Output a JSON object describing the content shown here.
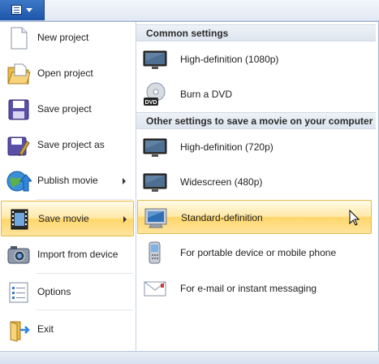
{
  "app_menu": {
    "left_items": [
      {
        "label": "New project",
        "icon": "new-project-icon",
        "has_submenu": false
      },
      {
        "label": "Open project",
        "icon": "open-project-icon",
        "has_submenu": false
      },
      {
        "label": "Save project",
        "icon": "save-project-icon",
        "has_submenu": false
      },
      {
        "label": "Save project as",
        "icon": "save-project-as-icon",
        "has_submenu": false
      },
      {
        "label": "Publish movie",
        "icon": "publish-movie-icon",
        "has_submenu": true
      },
      {
        "label": "Save movie",
        "icon": "save-movie-icon",
        "has_submenu": true,
        "highlighted": true
      },
      {
        "label": "Import from device",
        "icon": "import-device-icon",
        "has_submenu": false
      },
      {
        "label": "Options",
        "icon": "options-icon",
        "has_submenu": false
      },
      {
        "label": "Exit",
        "icon": "exit-icon",
        "has_submenu": false
      }
    ]
  },
  "submenu": {
    "common_header": "Common settings",
    "common_items": [
      {
        "label": "High-definition (1080p)",
        "icon": "monitor-icon"
      },
      {
        "label": "Burn a DVD",
        "icon": "dvd-icon"
      }
    ],
    "other_header": "Other settings to save a movie on your computer",
    "other_items": [
      {
        "label": "High-definition (720p)",
        "icon": "monitor-icon"
      },
      {
        "label": "Widescreen (480p)",
        "icon": "monitor-icon"
      },
      {
        "label": "Standard-definition",
        "icon": "crt-monitor-icon",
        "highlighted": true
      },
      {
        "label": "For portable device or mobile phone",
        "icon": "mobile-phone-icon"
      },
      {
        "label": "For e-mail or instant messaging",
        "icon": "email-icon"
      }
    ],
    "dvd_icon_text": "DVD"
  },
  "colors": {
    "highlight_top": "#fffbe7",
    "highlight_bottom": "#ffd66b",
    "highlight_border": "#e6b94b",
    "app_button": "#2a63b5"
  }
}
